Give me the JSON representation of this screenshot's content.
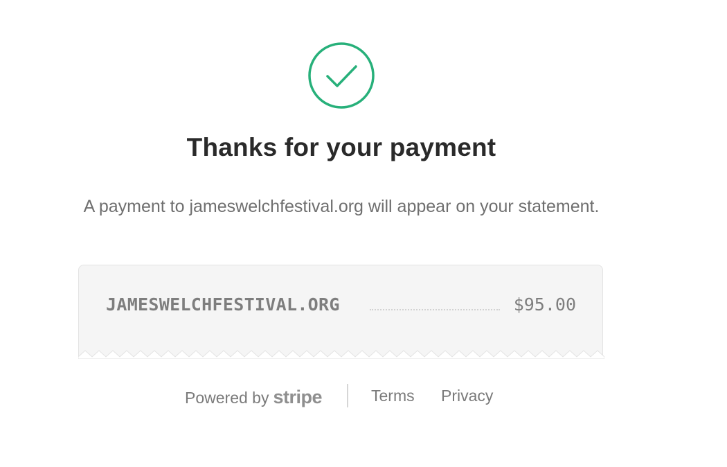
{
  "confirmation": {
    "title": "Thanks for your payment",
    "message": "A payment to jameswelchfestival.org will appear on your statement.",
    "icon": "checkmark-circle-icon",
    "accent_color": "#27b07a"
  },
  "receipt": {
    "merchant": "JAMESWELCHFESTIVAL.ORG",
    "amount": "$95.00"
  },
  "footer": {
    "powered_by_label": "Powered by",
    "brand": "stripe",
    "terms_label": "Terms",
    "privacy_label": "Privacy"
  }
}
